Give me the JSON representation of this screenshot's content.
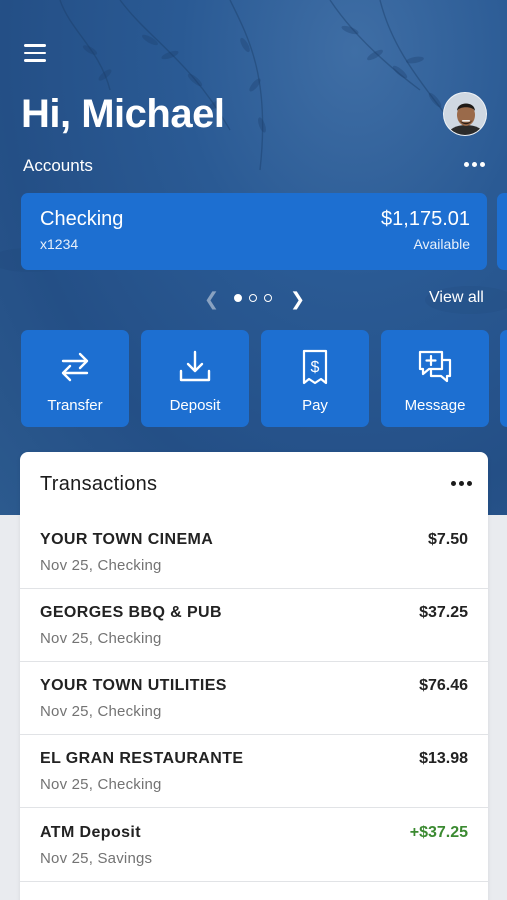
{
  "header": {
    "greeting": "Hi, Michael",
    "accounts_label": "Accounts"
  },
  "account": {
    "name": "Checking",
    "number": "x1234",
    "balance": "$1,175.01",
    "balance_label": "Available"
  },
  "pager": {
    "view_all": "View all",
    "page_count": 3,
    "current_page": 1
  },
  "actions": [
    {
      "label": "Transfer",
      "icon": "transfer-icon"
    },
    {
      "label": "Deposit",
      "icon": "deposit-icon"
    },
    {
      "label": "Pay",
      "icon": "pay-icon"
    },
    {
      "label": "Message",
      "icon": "message-icon"
    }
  ],
  "transactions": {
    "title": "Transactions",
    "items": [
      {
        "merchant": "YOUR TOWN CINEMA",
        "meta": "Nov 25, Checking",
        "amount": "$7.50"
      },
      {
        "merchant": "GEORGES BBQ & PUB",
        "meta": "Nov 25, Checking",
        "amount": "$37.25"
      },
      {
        "merchant": "YOUR TOWN UTILITIES",
        "meta": "Nov 25, Checking",
        "amount": "$76.46"
      },
      {
        "merchant": "EL GRAN RESTAURANTE",
        "meta": "Nov 25, Checking",
        "amount": "$13.98"
      },
      {
        "merchant": "ATM Deposit",
        "meta": "Nov 25, Savings",
        "amount": "+$37.25"
      }
    ]
  },
  "colors": {
    "accent": "#1d6fd1",
    "hero": "#2a5a94",
    "credit": "#3b8a31"
  }
}
